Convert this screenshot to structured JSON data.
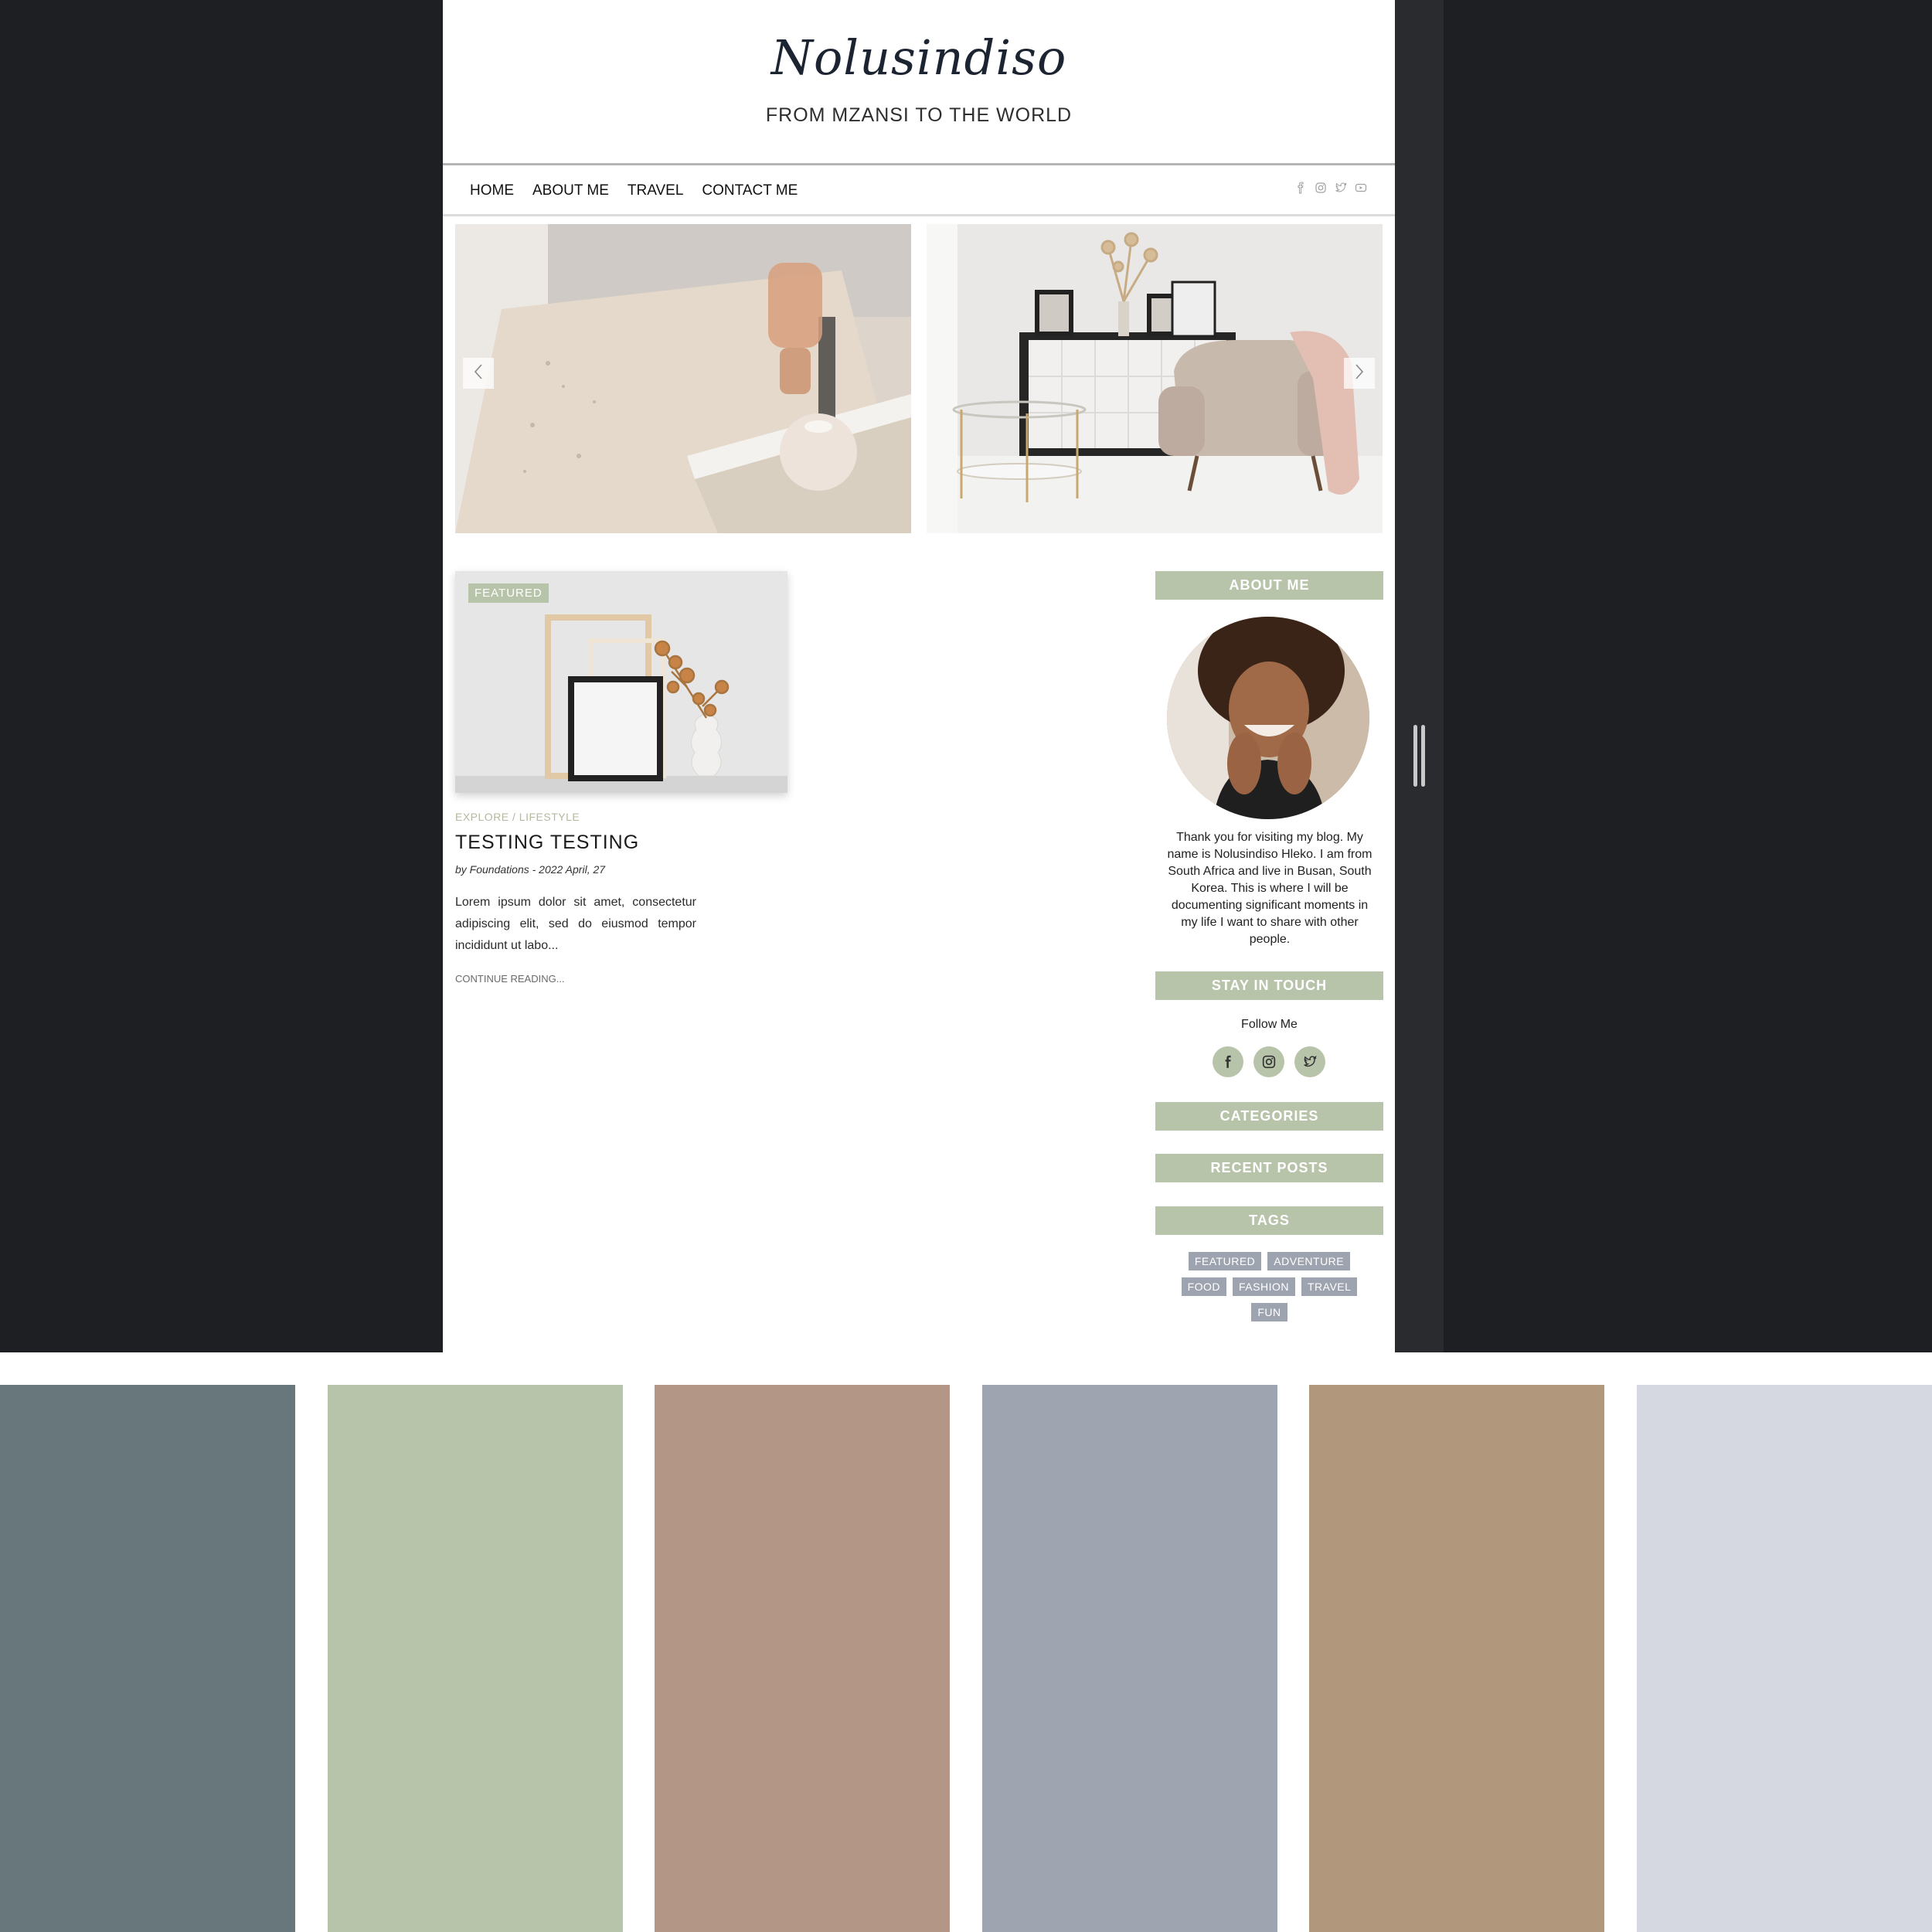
{
  "header": {
    "blog_title": "Nolusindiso",
    "tagline": "FROM MZANSI TO THE WORLD"
  },
  "nav": {
    "items": [
      {
        "label": "HOME"
      },
      {
        "label": "ABOUT ME"
      },
      {
        "label": "TRAVEL"
      },
      {
        "label": "CONTACT ME"
      }
    ],
    "social_icons": [
      "facebook-icon",
      "instagram-icon",
      "twitter-icon",
      "youtube-icon"
    ]
  },
  "slider": {
    "prev_icon": "chevron-left-icon",
    "next_icon": "chevron-right-icon"
  },
  "post": {
    "badge": "FEATURED",
    "categories": "EXPLORE / LIFESTYLE",
    "title": "TESTING TESTING",
    "meta": "by Foundations - 2022 April, 27",
    "excerpt": "Lorem ipsum dolor sit amet, consectetur adipiscing elit, sed do eiusmod tempor incididunt ut labo...",
    "continue_label": "CONTINUE READING..."
  },
  "sidebar": {
    "about_heading": "ABOUT ME",
    "about_text": "Thank you for visiting my blog. My name is Nolusindiso Hleko. I am from South Africa and live in Busan, South Korea. This is where I will be documenting significant moments in my life I want to share with other people.",
    "stay_heading": "STAY IN TOUCH",
    "follow_label": "Follow Me",
    "categories_heading": "CATEGORIES",
    "recent_heading": "RECENT POSTS",
    "tags_heading": "TAGS",
    "tags": [
      "FEATURED",
      "ADVENTURE",
      "FOOD",
      "FASHION",
      "TRAVEL",
      "FUN"
    ]
  },
  "colors": {
    "accent_green": "#b8c4aa",
    "tag_gray": "#9ea3b0",
    "backdrop": "#1e1f22",
    "palette": [
      "#68777b",
      "#b8c4aa",
      "#b39686",
      "#9ea4b0",
      "#b1987c",
      "#d5d8e0"
    ]
  }
}
